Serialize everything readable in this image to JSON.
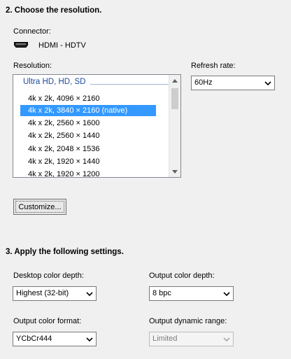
{
  "section2": {
    "title": "2. Choose the resolution."
  },
  "connector": {
    "label": "Connector:",
    "value": "HDMI - HDTV",
    "icon": "hdmi-icon"
  },
  "resolution": {
    "label": "Resolution:",
    "group": "Ultra HD, HD, SD",
    "items": [
      "4k x 2k, 4096 × 2160",
      "4k x 2k, 3840 × 2160 (native)",
      "4k x 2k, 2560 × 1600",
      "4k x 2k, 2560 × 1440",
      "4k x 2k, 2048 × 1536",
      "4k x 2k, 1920 × 1440",
      "4k x 2k, 1920 × 1200"
    ],
    "selected_index": 1
  },
  "refresh_rate": {
    "label": "Refresh rate:",
    "value": "60Hz"
  },
  "customize_button": {
    "label": "Customize..."
  },
  "section3": {
    "title": "3. Apply the following settings."
  },
  "desktop_color_depth": {
    "label": "Desktop color depth:",
    "value": "Highest (32-bit)"
  },
  "output_color_depth": {
    "label": "Output color depth:",
    "value": "8 bpc"
  },
  "output_color_format": {
    "label": "Output color format:",
    "value": "YCbCr444"
  },
  "output_dynamic_range": {
    "label": "Output dynamic range:",
    "value": "Limited",
    "enabled": false
  },
  "colors": {
    "selection": "#3399ff",
    "group_header": "#1e4a9c",
    "background": "#f0f0f0"
  }
}
